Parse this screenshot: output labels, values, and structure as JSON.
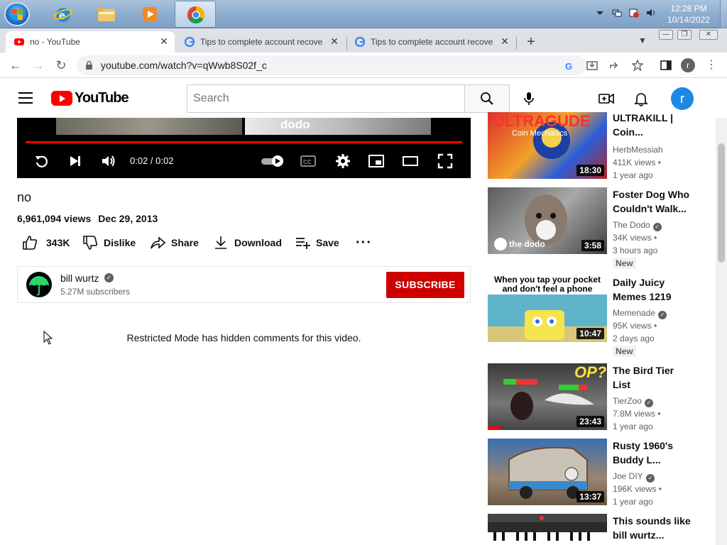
{
  "taskbar": {
    "clock_time": "12:28 PM",
    "clock_date": "10/14/2022"
  },
  "tabs": [
    {
      "title": "no - YouTube"
    },
    {
      "title": "Tips to complete account recove"
    },
    {
      "title": "Tips to complete account recove"
    }
  ],
  "toolbar": {
    "url": "youtube.com/watch?v=qWwb8S02f_c",
    "profile_initial": "r"
  },
  "header": {
    "logo_text": "YouTube",
    "search_placeholder": "Search",
    "avatar_initial": "r"
  },
  "player": {
    "thumb_text": "dodo",
    "time": "0:02 / 0:02",
    "progress_fraction": 1.0
  },
  "video": {
    "title": "no",
    "views": "6,961,094 views",
    "date": "Dec 29, 2013",
    "actions": {
      "like": "343K",
      "dislike": "Dislike",
      "share": "Share",
      "download": "Download",
      "save": "Save"
    }
  },
  "channel": {
    "name": "bill wurtz",
    "subscribers": "5.27M subscribers",
    "subscribe_label": "SUBSCRIBE"
  },
  "comments": {
    "restricted_message": "Restricted Mode has hidden comments for this video."
  },
  "recommendations": [
    {
      "title": "ULTRAKILL | Coin...",
      "channel": "HerbMessiah",
      "views": "411K views •",
      "age": "1 year ago",
      "duration": "18:30",
      "badge": "",
      "thumb_text": "Coin Mechanics"
    },
    {
      "title": "Foster Dog Who Couldn't Walk...",
      "channel": "The Dodo",
      "views": "34K views •",
      "age": "3 hours ago",
      "duration": "3:58",
      "badge": "New",
      "thumb_text": "the dodo"
    },
    {
      "title": "Daily Juicy Memes 1219",
      "channel": "Memenade",
      "views": "95K views •",
      "age": "2 days ago",
      "duration": "10:47",
      "badge": "New",
      "thumb_text": "When you tap your pocket and don't feel a phone"
    },
    {
      "title": "The Bird Tier List",
      "channel": "TierZoo",
      "views": "7.8M views •",
      "age": "1 year ago",
      "duration": "23:43",
      "badge": "",
      "thumb_text": "OP?"
    },
    {
      "title": "Rusty 1960's Buddy L...",
      "channel": "Joe DIY",
      "views": "196K views •",
      "age": "1 year ago",
      "duration": "13:37",
      "badge": "",
      "thumb_text": ""
    },
    {
      "title": "This sounds like bill wurtz...",
      "channel": "",
      "views": "",
      "age": "",
      "duration": "",
      "badge": "",
      "thumb_text": ""
    }
  ],
  "colors": {
    "youtube_red": "#ff0000",
    "subscribe_red": "#cc0000",
    "taskbar_blue": "#8eaecf",
    "tabstrip_gray": "#dee1e6",
    "avatar_blue": "#1e88e5"
  }
}
